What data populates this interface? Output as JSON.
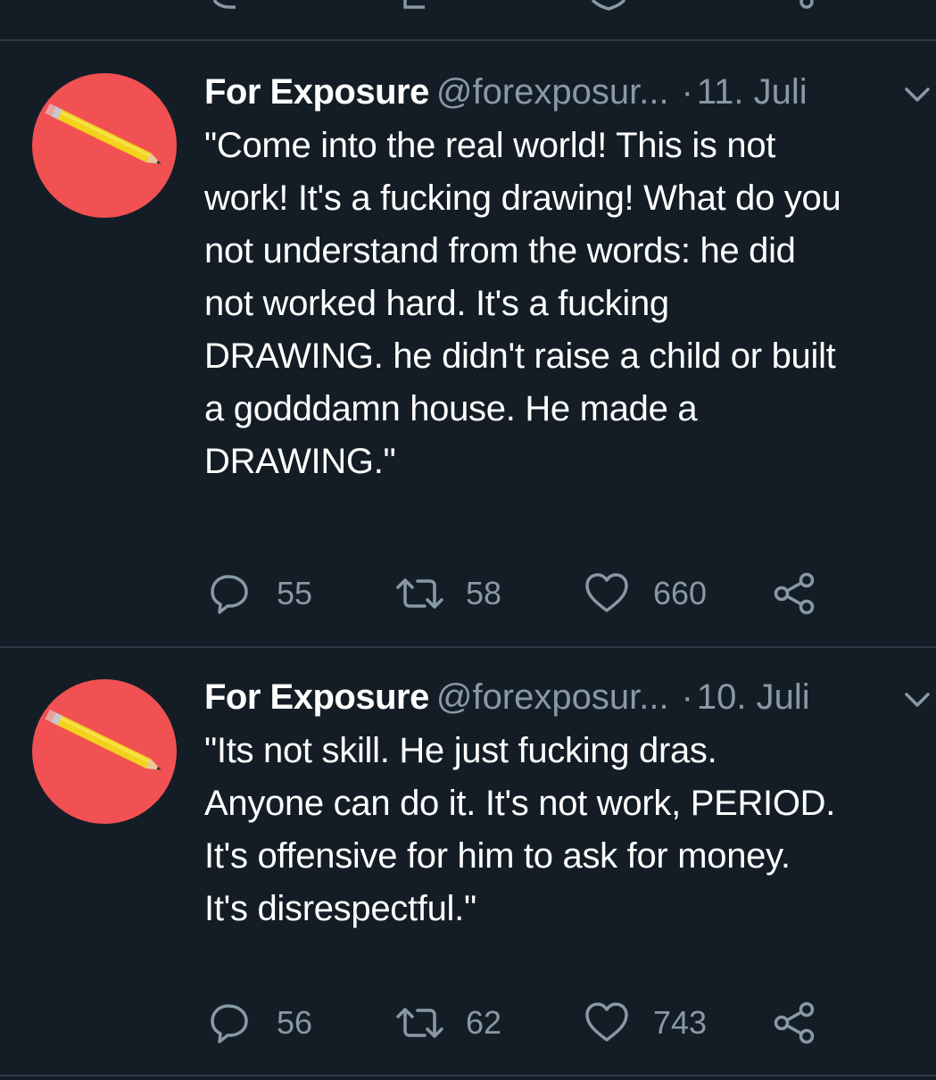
{
  "tweets": [
    {
      "author": "For Exposure",
      "handle": "@forexposur...",
      "separator": "·",
      "date": "11. Juli",
      "text_lines": [
        "\"Come into the real world! This is not",
        "work! It's a fucking drawing! What do you",
        "not understand from the words: he did",
        "not worked hard. It's a fucking",
        "DRAWING. he didn't raise a child or built",
        "a godddamn house. He made a",
        "DRAWING.\""
      ],
      "replies": "55",
      "retweets": "58",
      "likes": "660"
    },
    {
      "author": "For Exposure",
      "handle": "@forexposur...",
      "separator": "·",
      "date": "10. Juli",
      "text_lines": [
        "\"Its not skill. He just fucking dras.",
        "Anyone can do it. It's not work, PERIOD.",
        "It's offensive for him to ask for money.",
        "It's disrespectful.\""
      ],
      "replies": "56",
      "retweets": "62",
      "likes": "743"
    }
  ],
  "icons": {
    "avatar": "pencil-on-red-circle",
    "reply": "reply-icon",
    "retweet": "retweet-icon",
    "like": "heart-icon",
    "share": "share-icon",
    "menu": "chevron-down-icon"
  },
  "colors": {
    "background": "#141d26",
    "divider": "#2b3947",
    "text": "#ffffff",
    "secondary": "#8899a6",
    "avatar": "#f15152"
  }
}
